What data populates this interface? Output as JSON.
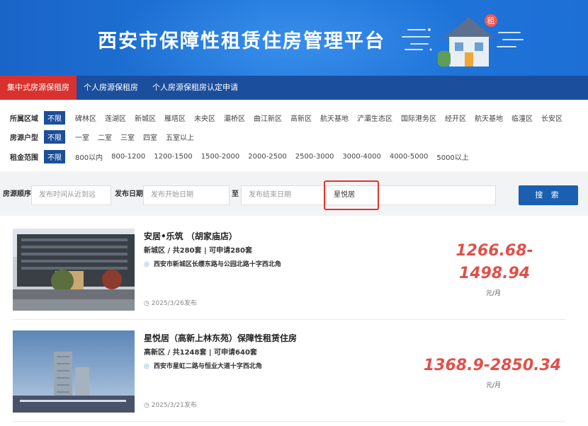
{
  "banner": {
    "title": "西安市保障性租赁住房管理平台",
    "badge": "租"
  },
  "tabs": [
    {
      "label": "集中式房源保租房",
      "active": true
    },
    {
      "label": "个人房源保租房",
      "active": false
    },
    {
      "label": "个人房源保租房认定申请",
      "active": false
    }
  ],
  "filters": {
    "area": {
      "label": "所属区域",
      "options": [
        "不限",
        "碑林区",
        "莲湖区",
        "新城区",
        "雁塔区",
        "未央区",
        "灞桥区",
        "曲江新区",
        "高新区",
        "航天基地",
        "浐灞生态区",
        "国际港务区",
        "经开区",
        "航天基地",
        "临潼区",
        "长安区"
      ]
    },
    "type": {
      "label": "房源户型",
      "options": [
        "不限",
        "一室",
        "二室",
        "三室",
        "四室",
        "五室以上"
      ]
    },
    "rent": {
      "label": "租金范围",
      "options": [
        "不限",
        "800以内",
        "800-1200",
        "1200-1500",
        "1500-2000",
        "2000-2500",
        "2500-3000",
        "3000-4000",
        "4000-5000",
        "5000以上"
      ]
    }
  },
  "search": {
    "order_label": "房源顺序",
    "order_placeholder": "发布时间从近到远",
    "date_label": "发布日期",
    "start_placeholder": "发布开始日期",
    "to_label": "至",
    "end_placeholder": "发布结束日期",
    "keyword_value": "星悦居",
    "button_label": "搜 索"
  },
  "listings": [
    {
      "name": "安居•乐筑  （胡家庙店）",
      "meta": "新城区  / 共280套 | 可申请280套",
      "address": "西安市新城区长缨东路与公园北路十字西北角",
      "date": "2025/3/26发布",
      "price_line1": "1266.68-",
      "price_line2": "1498.94",
      "unit": "元/月"
    },
    {
      "name": "星悦居（高新上林东苑）保障性租赁住房",
      "meta": "高新区  / 共1248套 | 可申请640套",
      "address": "西安市星虹二路与恒业大道十字西北角",
      "date": "2025/3/21发布",
      "price_line1": "1368.9-2850.34",
      "price_line2": "",
      "unit": "元/月"
    }
  ],
  "colors": {
    "banner_blue": "#1f78db",
    "tab_bar": "#1b4f9e",
    "tab_active": "#d8322f",
    "price": "#e0504a",
    "highlight_box": "#e0342e"
  }
}
